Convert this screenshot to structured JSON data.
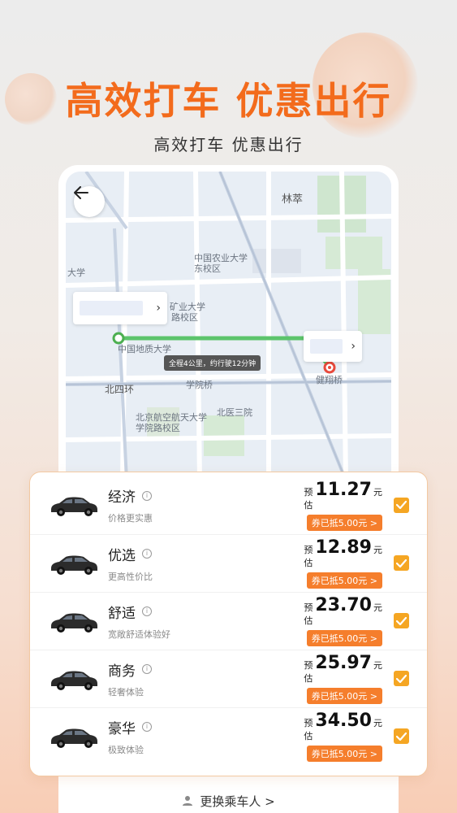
{
  "hero": {
    "title": "高效打车 优惠出行",
    "subtitle": "高效打车 优惠出行"
  },
  "map": {
    "labels": {
      "linCui": "林萃",
      "caau": "中国农业大学东校区",
      "cumt": "矿业大学",
      "cumtSub": "路校区",
      "daxue": "大学",
      "cugb": "中国地质大学",
      "beisihuan": "北四环",
      "xueyuanqiao": "学院桥",
      "jianxiangqiao": "健翔桥",
      "buaa": "北京航空航天大学学院路校区",
      "beiyisanyuan": "北医三院"
    },
    "route_tip": "全程4公里，约行驶12分钟",
    "colors": {
      "route": "#5cc46b",
      "pickup": "#4caf50",
      "dropoff": "#e84a3c"
    }
  },
  "ride_options": [
    {
      "name": "经济",
      "desc": "价格更实惠",
      "prefix": "预估",
      "price": "11.27",
      "unit": "元",
      "coupon": "券已抵5.00元 >",
      "checked": true
    },
    {
      "name": "优选",
      "desc": "更高性价比",
      "prefix": "预估",
      "price": "12.89",
      "unit": "元",
      "coupon": "券已抵5.00元 >",
      "checked": true
    },
    {
      "name": "舒适",
      "desc": "宽敞舒适体验好",
      "prefix": "预估",
      "price": "23.70",
      "unit": "元",
      "coupon": "券已抵5.00元 >",
      "checked": true
    },
    {
      "name": "商务",
      "desc": "轻奢体验",
      "prefix": "预估",
      "price": "25.97",
      "unit": "元",
      "coupon": "券已抵5.00元 >",
      "checked": true
    },
    {
      "name": "豪华",
      "desc": "极致体验",
      "prefix": "预估",
      "price": "34.50",
      "unit": "元",
      "coupon": "券已抵5.00元 >",
      "checked": true
    }
  ],
  "bottom": {
    "change_passenger": "更换乘车人 >"
  },
  "icons": {
    "back": "arrow-left-icon",
    "info": "info-icon",
    "check": "checkbox-checked-icon",
    "person": "person-icon",
    "car": "car-icon"
  },
  "colors": {
    "accent": "#f36b1c",
    "coupon": "#f57e2c",
    "check": "#f5a623"
  }
}
